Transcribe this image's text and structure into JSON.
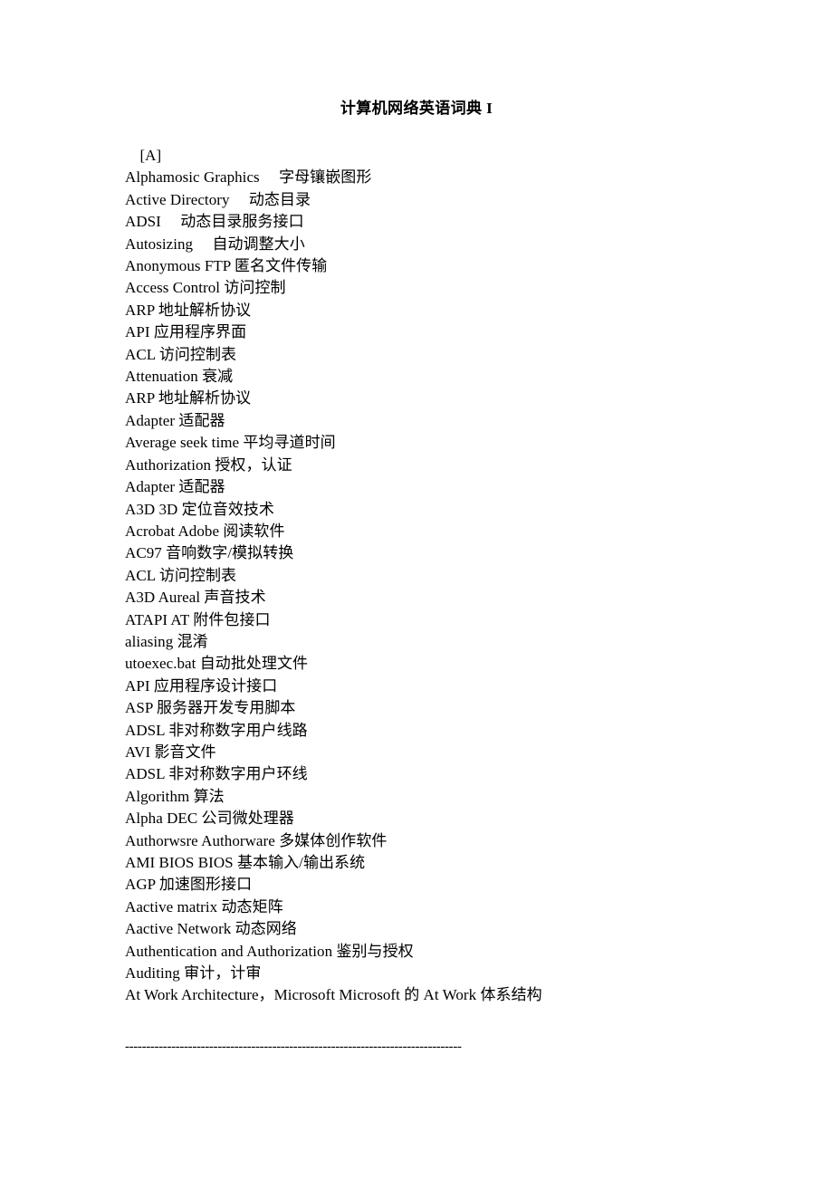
{
  "document": {
    "title": "计算机网络英语词典 I",
    "section_heading": "  [A]",
    "entries": [
      "Alphamosic Graphics　 字母镶嵌图形",
      "Active Directory　 动态目录",
      "ADSI　 动态目录服务接口",
      "Autosizing　 自动调整大小",
      "Anonymous FTP 匿名文件传输",
      "Access Control 访问控制",
      "ARP 地址解析协议",
      "API 应用程序界面",
      "ACL 访问控制表",
      "Attenuation 衰减",
      "ARP 地址解析协议",
      "Adapter 适配器",
      "Average seek time 平均寻道时间",
      "Authorization 授权，认证",
      "Adapter 适配器",
      "A3D 3D 定位音效技术",
      "Acrobat Adobe 阅读软件",
      "AC97 音响数字/模拟转换",
      "ACL 访问控制表",
      "A3D Aureal 声音技术",
      "ATAPI AT 附件包接口",
      "aliasing 混淆",
      "utoexec.bat 自动批处理文件",
      "API 应用程序设计接口",
      "ASP 服务器开发专用脚本",
      "ADSL 非对称数字用户线路",
      "AVI 影音文件",
      "ADSL 非对称数字用户环线",
      "Algorithm 算法",
      "Alpha DEC 公司微处理器",
      "Authorwsre Authorware 多媒体创作软件",
      "AMI BIOS BIOS 基本输入/输出系统",
      "AGP 加速图形接口",
      "Aactive matrix 动态矩阵",
      "Aactive Network 动态网络",
      "Authentication and Authorization 鉴别与授权",
      "Auditing 审计，计审",
      "At Work Architecture，Microsoft Microsoft 的 At Work 体系结构"
    ],
    "separator": "--------------------------------------------------------------------------------"
  }
}
